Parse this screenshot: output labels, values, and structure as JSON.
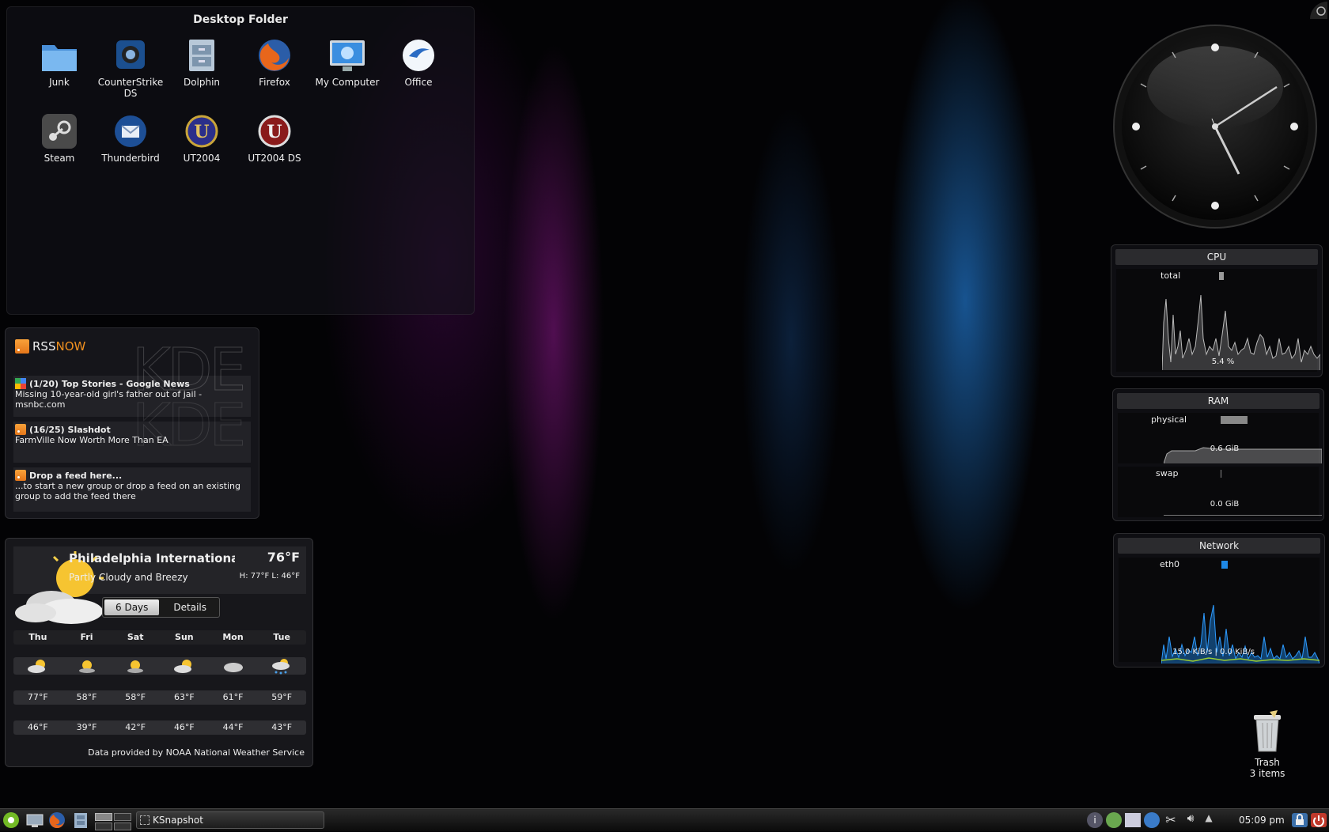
{
  "folder": {
    "title": "Desktop Folder",
    "icons": [
      {
        "label": "Junk",
        "icon": "folder-icon"
      },
      {
        "label": "CounterStrike DS",
        "icon": "counterstrike-icon"
      },
      {
        "label": "Dolphin",
        "icon": "dolphin-icon"
      },
      {
        "label": "Firefox",
        "icon": "firefox-icon"
      },
      {
        "label": "My Computer",
        "icon": "computer-icon"
      },
      {
        "label": "Office",
        "icon": "office-icon"
      },
      {
        "label": "Steam",
        "icon": "steam-icon"
      },
      {
        "label": "Thunderbird",
        "icon": "thunderbird-icon"
      },
      {
        "label": "UT2004",
        "icon": "ut2004-icon"
      },
      {
        "label": "UT2004 DS",
        "icon": "ut2004-ds-icon"
      }
    ]
  },
  "rss": {
    "logo_a": "RSS",
    "logo_b": "NOW",
    "feeds": [
      {
        "title": "(1/20) Top Stories - Google News",
        "body": "Missing 10-year-old girl's father out of jail - msnbc.com"
      },
      {
        "title": "(16/25) Slashdot",
        "body": "FarmVille Now Worth More Than EA"
      },
      {
        "title": "Drop a feed here...",
        "body": "...to start a new group or drop a feed on an existing group to add the feed there"
      }
    ]
  },
  "weather": {
    "location": "Philadelphia International Air",
    "temp": "76°F",
    "condition": "Partly Cloudy and Breezy",
    "hilo": "H: 77°F  L: 46°F",
    "tabs": [
      "6 Days",
      "Details"
    ],
    "days": [
      "Thu",
      "Fri",
      "Sat",
      "Sun",
      "Mon",
      "Tue"
    ],
    "highs": [
      "77°F",
      "58°F",
      "58°F",
      "63°F",
      "61°F",
      "59°F"
    ],
    "lows": [
      "46°F",
      "39°F",
      "42°F",
      "46°F",
      "44°F",
      "43°F"
    ],
    "credit": "Data provided by NOAA National Weather Service"
  },
  "cpu": {
    "title": "CPU",
    "label": "total",
    "value": "5.4 %",
    "fraction": 0.054
  },
  "ram": {
    "title": "RAM",
    "physical_label": "physical",
    "physical_value": "0.6 GiB",
    "swap_label": "swap",
    "swap_value": "0.0 GiB"
  },
  "network": {
    "title": "Network",
    "label": "eth0",
    "value": "15.0 KiB/s | 0.0 KiB/s"
  },
  "trash": {
    "label": "Trash",
    "count": "3 items"
  },
  "taskbar": {
    "task": "KSnapshot",
    "clock": "05:09 pm"
  },
  "colors": {
    "accent": "#1e88e5",
    "rss_orange": "#f0901f",
    "net_green": "#9acd32"
  }
}
